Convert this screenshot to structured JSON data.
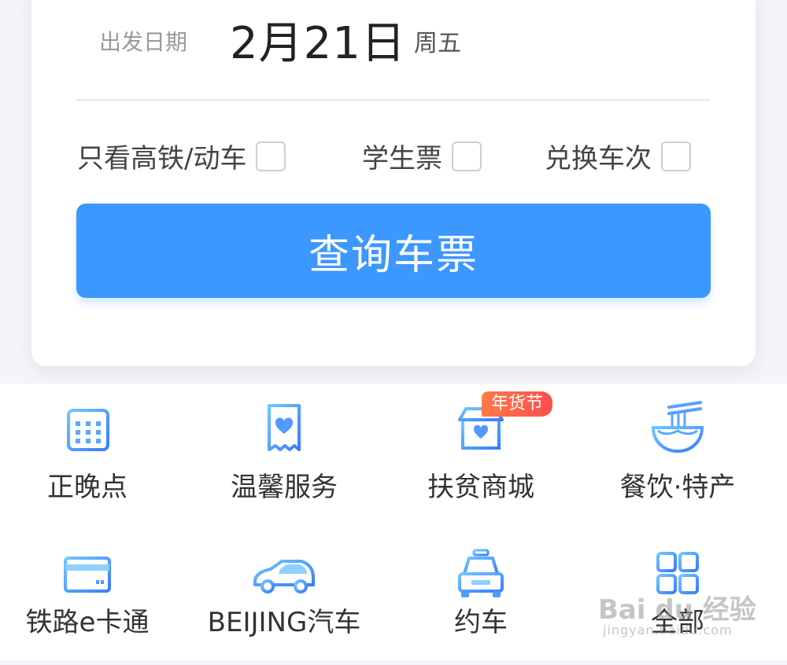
{
  "date": {
    "label": "出发日期",
    "value": "2月21日",
    "weekday": "周五"
  },
  "options": [
    {
      "label": "只看高铁/动车",
      "checked": false
    },
    {
      "label": "学生票",
      "checked": false
    },
    {
      "label": "兑换车次",
      "checked": false
    }
  ],
  "search_button": {
    "label": "查询车票"
  },
  "services": {
    "row1": [
      {
        "label": "正晚点",
        "icon": "calendar-icon"
      },
      {
        "label": "温馨服务",
        "icon": "ticket-heart-icon"
      },
      {
        "label": "扶贫商城",
        "icon": "shop-heart-icon",
        "badge": "年货节"
      },
      {
        "label": "餐饮·特产",
        "icon": "noodle-bowl-icon"
      }
    ],
    "row2": [
      {
        "label": "铁路e卡通",
        "icon": "card-icon"
      },
      {
        "label": "BEIJING汽车",
        "icon": "car-icon"
      },
      {
        "label": "约车",
        "icon": "taxi-icon"
      },
      {
        "label": "全部",
        "icon": "grid-icon"
      }
    ]
  },
  "colors": {
    "accent": "#3c97ff",
    "badge": "#ff5a4a",
    "icon_gradient_start": "#6fc6ff",
    "icon_gradient_end": "#3a7bff"
  },
  "watermark": {
    "main": "Bai du 经验",
    "sub": "jingyan.baidu.com"
  }
}
